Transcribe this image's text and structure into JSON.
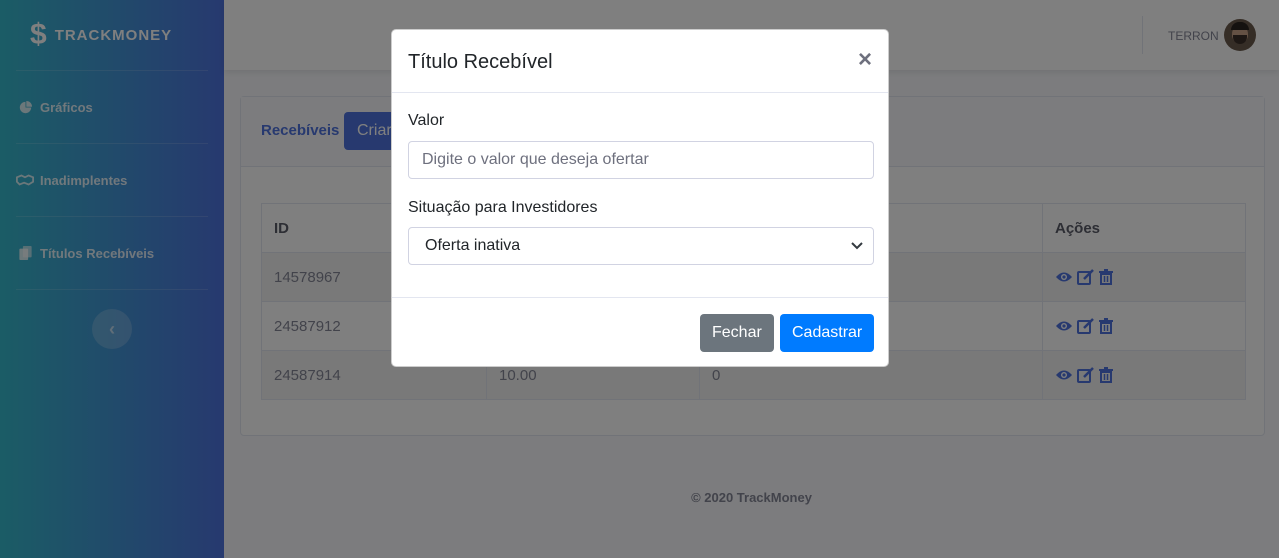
{
  "sidebar": {
    "brand_symbol": "$",
    "brand_name": "TRACKMONEY",
    "items": [
      {
        "label": "Gráficos",
        "icon": "pie-chart-icon"
      },
      {
        "label": "Inadimplentes",
        "icon": "handshake-icon"
      },
      {
        "label": "Títulos Recebíveis",
        "icon": "files-icon"
      }
    ],
    "toggle_glyph": "‹"
  },
  "topbar": {
    "user_name": "TERRON"
  },
  "card": {
    "title": "Recebíveis",
    "create_button": "Criar"
  },
  "table": {
    "headers": [
      "ID",
      "",
      "",
      "Ações"
    ],
    "rows": [
      {
        "id": "14578967",
        "valor": "",
        "situacao": ""
      },
      {
        "id": "24587912",
        "valor": "",
        "situacao": ""
      },
      {
        "id": "24587914",
        "valor": "10.00",
        "situacao": "0"
      }
    ]
  },
  "footer": {
    "text": "© 2020 TrackMoney"
  },
  "modal": {
    "title": "Título Recebível",
    "close": "×",
    "valor_label": "Valor",
    "valor_placeholder": "Digite o valor que deseja ofertar",
    "situacao_label": "Situação para Investidores",
    "situacao_selected": "Oferta inativa",
    "cancel_button": "Fechar",
    "submit_button": "Cadastrar"
  },
  "colors": {
    "primary": "#4e73df",
    "sidebar_start": "#36b9cc",
    "submit": "#007bff",
    "secondary": "#6c757d"
  }
}
